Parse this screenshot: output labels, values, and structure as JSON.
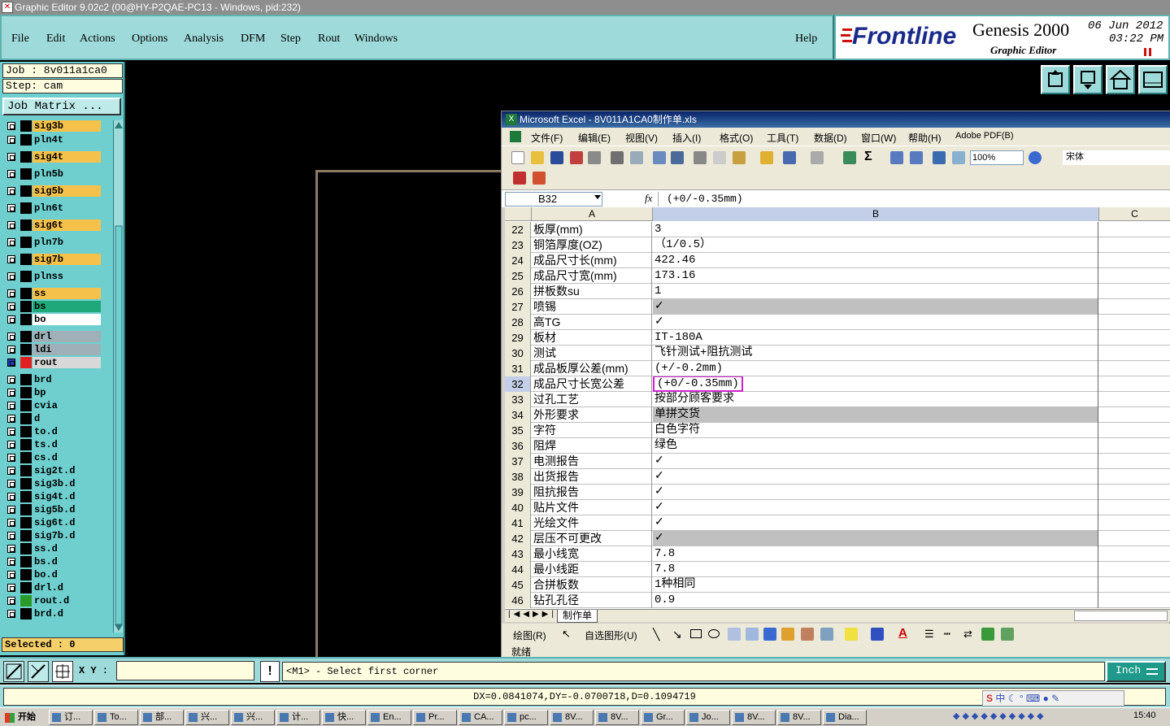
{
  "window": {
    "title": "Graphic Editor 9.02c2 (00@HY-P2QAE-PC13 - Windows, pid:232)"
  },
  "menu": {
    "items": [
      "File",
      "Edit",
      "Actions",
      "Options",
      "Analysis",
      "DFM",
      "Step",
      "Rout",
      "Windows"
    ],
    "help": "Help"
  },
  "brand": {
    "logo": "Frontline",
    "product": "Genesis 2000",
    "sub": "Graphic Editor",
    "date": "06 Jun 2012",
    "time": "03:22 PM"
  },
  "job": {
    "job_label": "Job : 8v011a1ca0",
    "step_label": "Step: cam",
    "matrix_button": "Job Matrix ...",
    "selected": "Selected : 0"
  },
  "layers": [
    {
      "name": "sig3b",
      "color": "#f5c14a"
    },
    {
      "name": "pln4t",
      "color": "#6fcfcf"
    },
    {
      "name": "sig4t",
      "color": "#f5c14a"
    },
    {
      "name": "pln5b",
      "color": "#6fcfcf"
    },
    {
      "name": "sig5b",
      "color": "#f5c14a"
    },
    {
      "name": "pln6t",
      "color": "#6fcfcf"
    },
    {
      "name": "sig6t",
      "color": "#f5c14a"
    },
    {
      "name": "pln7b",
      "color": "#6fcfcf"
    },
    {
      "name": "sig7b",
      "color": "#f5c14a"
    },
    {
      "name": "plnss",
      "color": "#6fcfcf"
    },
    {
      "name": "ss",
      "color": "#f5c14a"
    },
    {
      "name": "bs",
      "color": "#1fa87a"
    },
    {
      "name": "bo",
      "color": "#ffffff"
    },
    {
      "name": "drl",
      "color": "#a0b0b8"
    },
    {
      "name": "ldi",
      "color": "#a0b0b8"
    },
    {
      "name": "rout",
      "color": "#d8d8d8"
    },
    {
      "name": "brd",
      "color": "#6fcfcf"
    },
    {
      "name": "bp",
      "color": "#6fcfcf"
    },
    {
      "name": "cvia",
      "color": "#6fcfcf"
    },
    {
      "name": "d",
      "color": "#6fcfcf"
    },
    {
      "name": "to.d",
      "color": "#6fcfcf"
    },
    {
      "name": "ts.d",
      "color": "#6fcfcf"
    },
    {
      "name": "cs.d",
      "color": "#6fcfcf"
    },
    {
      "name": "sig2t.d",
      "color": "#6fcfcf"
    },
    {
      "name": "sig3b.d",
      "color": "#6fcfcf"
    },
    {
      "name": "sig4t.d",
      "color": "#6fcfcf"
    },
    {
      "name": "sig5b.d",
      "color": "#6fcfcf"
    },
    {
      "name": "sig6t.d",
      "color": "#6fcfcf"
    },
    {
      "name": "sig7b.d",
      "color": "#6fcfcf"
    },
    {
      "name": "ss.d",
      "color": "#6fcfcf"
    },
    {
      "name": "bs.d",
      "color": "#6fcfcf"
    },
    {
      "name": "bo.d",
      "color": "#6fcfcf"
    },
    {
      "name": "drl.d",
      "color": "#6fcfcf"
    },
    {
      "name": "rout.d",
      "color": "#6fcfcf"
    },
    {
      "name": "brd.d",
      "color": "#6fcfcf"
    }
  ],
  "excel": {
    "title": "Microsoft Excel - 8V011A1CA0制作单.xls",
    "menu": [
      "文件(F)",
      "编辑(E)",
      "视图(V)",
      "插入(I)",
      "格式(O)",
      "工具(T)",
      "数据(D)",
      "窗口(W)",
      "帮助(H)",
      "Adobe PDF(B)"
    ],
    "zoom": "100%",
    "font": "宋体",
    "namebox": "B32",
    "formula": "(+0/-0.35mm)",
    "columns": [
      "A",
      "B",
      "C"
    ],
    "rows": [
      {
        "n": "22",
        "a": "板厚(mm)",
        "b": "3"
      },
      {
        "n": "23",
        "a": "铜箔厚度(OZ)",
        "b": "（1/0.5）"
      },
      {
        "n": "24",
        "a": "成品尺寸长(mm)",
        "b": "422.46"
      },
      {
        "n": "25",
        "a": "成品尺寸宽(mm)",
        "b": "173.16"
      },
      {
        "n": "26",
        "a": "拼板数su",
        "b": "1"
      },
      {
        "n": "27",
        "a": "喷锡",
        "b": "✓",
        "gray": true
      },
      {
        "n": "28",
        "a": "高TG",
        "b": "✓"
      },
      {
        "n": "29",
        "a": "板材",
        "b": "IT-180A"
      },
      {
        "n": "30",
        "a": "测试",
        "b": "飞针测试+阻抗测试"
      },
      {
        "n": "31",
        "a": "成品板厚公差(mm)",
        "b": "(+/-0.2mm)"
      },
      {
        "n": "32",
        "a": "成品尺寸长宽公差",
        "b": "(+0/-0.35mm)",
        "selected": true
      },
      {
        "n": "33",
        "a": "过孔工艺",
        "b": "按部分顾客要求"
      },
      {
        "n": "34",
        "a": "外形要求",
        "b": "单拼交货",
        "gray": true
      },
      {
        "n": "35",
        "a": "字符",
        "b": "白色字符"
      },
      {
        "n": "36",
        "a": "阻焊",
        "b": "绿色"
      },
      {
        "n": "37",
        "a": "电测报告",
        "b": "✓"
      },
      {
        "n": "38",
        "a": "出货报告",
        "b": "✓"
      },
      {
        "n": "39",
        "a": "阻抗报告",
        "b": "✓"
      },
      {
        "n": "40",
        "a": "贴片文件",
        "b": "✓"
      },
      {
        "n": "41",
        "a": "光绘文件",
        "b": "✓"
      },
      {
        "n": "42",
        "a": "层压不可更改",
        "b": "✓",
        "gray": true
      },
      {
        "n": "43",
        "a": "最小线宽",
        "b": "7.8"
      },
      {
        "n": "44",
        "a": "最小线距",
        "b": "7.8"
      },
      {
        "n": "45",
        "a": "合拼板数",
        "b": "1种相同"
      },
      {
        "n": "46",
        "a": "钻孔孔径",
        "b": "0.9"
      }
    ],
    "sheet_tab": "制作单",
    "drawbar": {
      "draw": "绘图(R)",
      "autoshapes": "自选图形(U)"
    },
    "status": "就绪"
  },
  "command": {
    "xy_label": "X Y :",
    "message": "<M1> - Select first corner",
    "units": "Inch"
  },
  "coords": "DX=0.0841074,DY=-0.0700718,D=0.1094719",
  "taskbar": {
    "start": "开始",
    "tasks": [
      "订...",
      "To...",
      "部...",
      "兴...",
      "兴...",
      "计...",
      "快...",
      "En...",
      "Pr...",
      "CA...",
      "pc...",
      "8V...",
      "8V...",
      "Gr...",
      "Jo...",
      "8V...",
      "8V...",
      "Dia..."
    ],
    "clock": "15:40"
  }
}
